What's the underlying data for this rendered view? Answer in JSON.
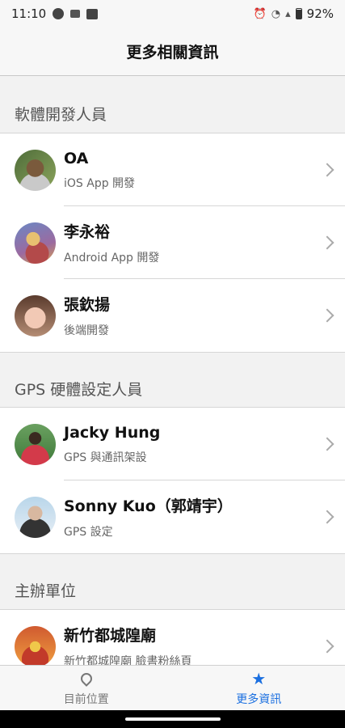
{
  "status_bar": {
    "time": "11:10",
    "battery": "92%"
  },
  "nav": {
    "title": "更多相關資訊"
  },
  "sections": [
    {
      "header": "軟體開發人員",
      "rows": [
        {
          "name": "OA",
          "subtitle": "iOS App 開發"
        },
        {
          "name": "李永裕",
          "subtitle": "Android App 開發"
        },
        {
          "name": "張欽揚",
          "subtitle": "後端開發"
        }
      ]
    },
    {
      "header": "GPS 硬體設定人員",
      "rows": [
        {
          "name": "Jacky Hung",
          "subtitle": "GPS 與通訊架設"
        },
        {
          "name": "Sonny Kuo（郭靖宇）",
          "subtitle": "GPS 設定"
        }
      ]
    },
    {
      "header": "主辦單位",
      "rows": [
        {
          "name": "新竹都城隍廟",
          "subtitle": "新竹都城隍廟 臉書粉絲頁"
        }
      ]
    }
  ],
  "tabs": [
    {
      "label": "目前位置",
      "icon": "location-pin-icon",
      "active": false
    },
    {
      "label": "更多資訊",
      "icon": "star-icon",
      "active": true
    }
  ],
  "colors": {
    "accent": "#1a6fe0",
    "background": "#f2f2f2"
  }
}
